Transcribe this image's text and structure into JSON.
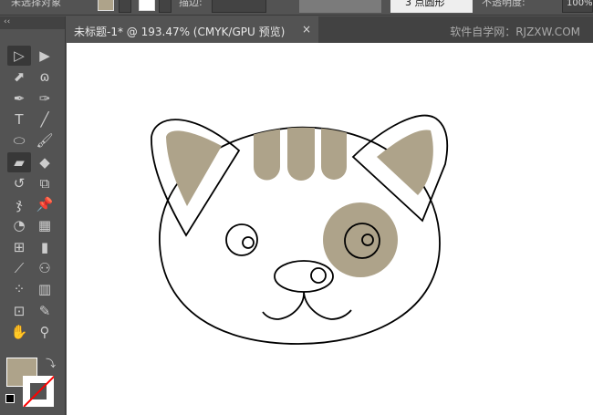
{
  "control_bar": {
    "selection": "未选择对象",
    "fill_color": "#aea38a",
    "stroke_label": "描边:",
    "brush": "3 点圆形",
    "opacity_label": "不透明度:",
    "opacity": "100%"
  },
  "document": {
    "tab_title": "未标题-1* @ 193.47% (CMYK/GPU 预览)",
    "close": "×",
    "watermark": "软件自学网：RJZXW.COM"
  },
  "toolbar": {
    "collapse": "‹‹",
    "tools": [
      {
        "name": "selection-tool",
        "glyph": "▷"
      },
      {
        "name": "direct-selection-tool",
        "glyph": "▶"
      },
      {
        "name": "add-anchor-tool",
        "glyph": "⬈"
      },
      {
        "name": "lasso-tool",
        "glyph": "ɷ"
      },
      {
        "name": "pen-tool",
        "glyph": "✒"
      },
      {
        "name": "curvature-tool",
        "glyph": "✑"
      },
      {
        "name": "type-tool",
        "glyph": "T"
      },
      {
        "name": "line-tool",
        "glyph": "╱"
      },
      {
        "name": "ellipse-tool",
        "glyph": "⬭"
      },
      {
        "name": "paintbrush-tool",
        "glyph": "🖌"
      },
      {
        "name": "blob-brush-tool",
        "glyph": "▰"
      },
      {
        "name": "eraser-tool",
        "glyph": "◆"
      },
      {
        "name": "rotate-tool",
        "glyph": "↺"
      },
      {
        "name": "scale-tool",
        "glyph": "⧉"
      },
      {
        "name": "puppet-warp-tool",
        "glyph": "ჯ"
      },
      {
        "name": "pin-tool",
        "glyph": "📌"
      },
      {
        "name": "shape-builder-tool",
        "glyph": "◔"
      },
      {
        "name": "perspective-grid-tool",
        "glyph": "▦"
      },
      {
        "name": "mesh-tool",
        "glyph": "⊞"
      },
      {
        "name": "gradient-tool",
        "glyph": "▮"
      },
      {
        "name": "eyedropper-tool",
        "glyph": "⟋"
      },
      {
        "name": "blend-tool",
        "glyph": "⚇"
      },
      {
        "name": "symbol-sprayer-tool",
        "glyph": "⁘"
      },
      {
        "name": "column-graph-tool",
        "glyph": "▥"
      },
      {
        "name": "artboard-tool",
        "glyph": "⊡"
      },
      {
        "name": "knife-tool",
        "glyph": "✎"
      },
      {
        "name": "hand-tool",
        "glyph": "✋"
      },
      {
        "name": "zoom-tool",
        "glyph": "⚲"
      }
    ],
    "fill": "#aea38a",
    "stroke": "none"
  },
  "colors": {
    "tan": "#aea38a"
  }
}
